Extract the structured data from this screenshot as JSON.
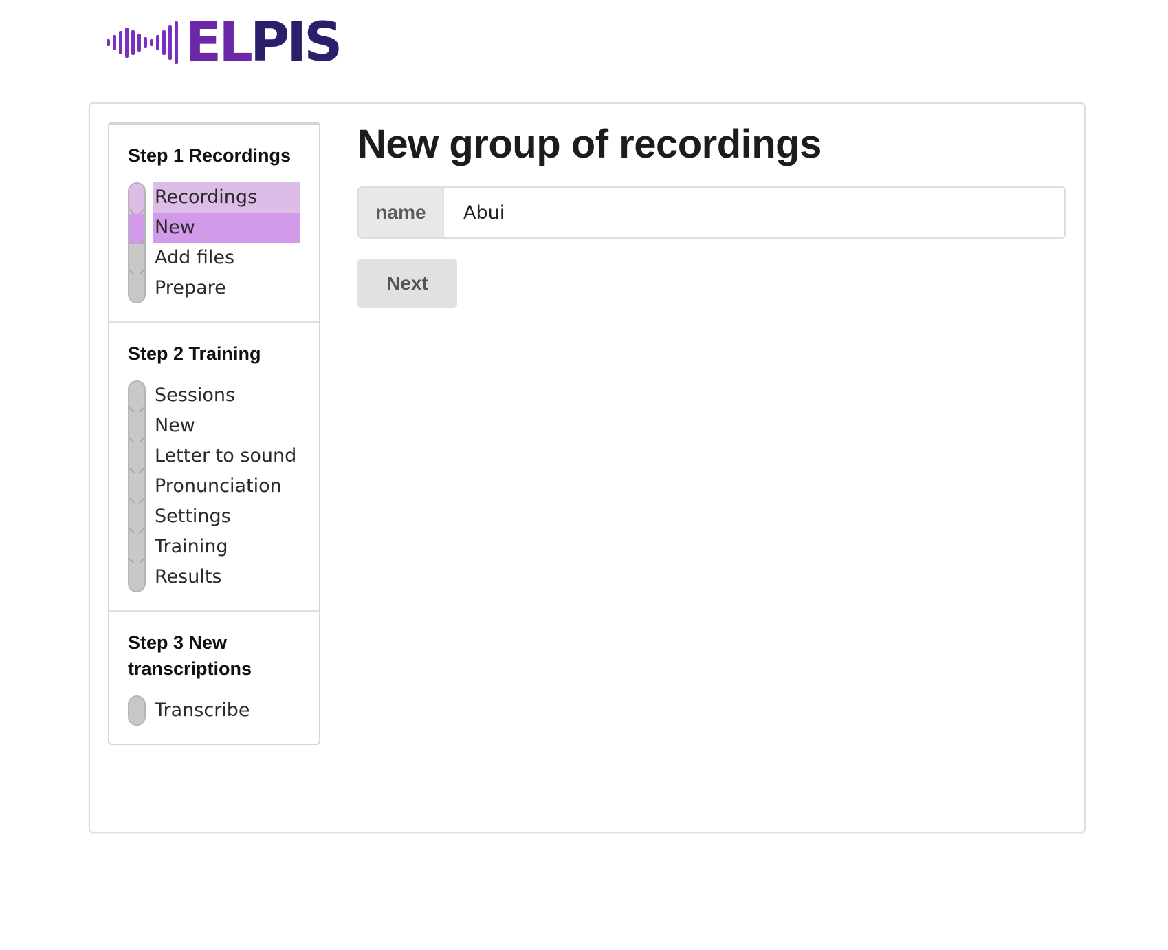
{
  "logo": {
    "text_a": "EL",
    "text_b": "PIS"
  },
  "steps": [
    {
      "title": "Step 1 Recordings",
      "items": [
        {
          "label": "Recordings",
          "state": "done"
        },
        {
          "label": "New",
          "state": "active"
        },
        {
          "label": "Add files",
          "state": "pending"
        },
        {
          "label": "Prepare",
          "state": "pending"
        }
      ]
    },
    {
      "title": "Step 2 Training",
      "items": [
        {
          "label": "Sessions",
          "state": "pending"
        },
        {
          "label": "New",
          "state": "pending"
        },
        {
          "label": "Letter to sound",
          "state": "pending"
        },
        {
          "label": "Pronunciation",
          "state": "pending"
        },
        {
          "label": "Settings",
          "state": "pending"
        },
        {
          "label": "Training",
          "state": "pending"
        },
        {
          "label": "Results",
          "state": "pending"
        }
      ]
    },
    {
      "title": "Step 3 New transcriptions",
      "items": [
        {
          "label": "Transcribe",
          "state": "pending"
        }
      ]
    }
  ],
  "main": {
    "heading": "New group of recordings",
    "name_field": {
      "label": "name",
      "value": "Abui"
    },
    "next_label": "Next"
  },
  "colors": {
    "brand_purple": "#6d28a8",
    "brand_navy": "#2b1e6b",
    "step_done": "#dcbde8",
    "step_active": "#d29bea",
    "step_pending": "#c8c8c8"
  }
}
